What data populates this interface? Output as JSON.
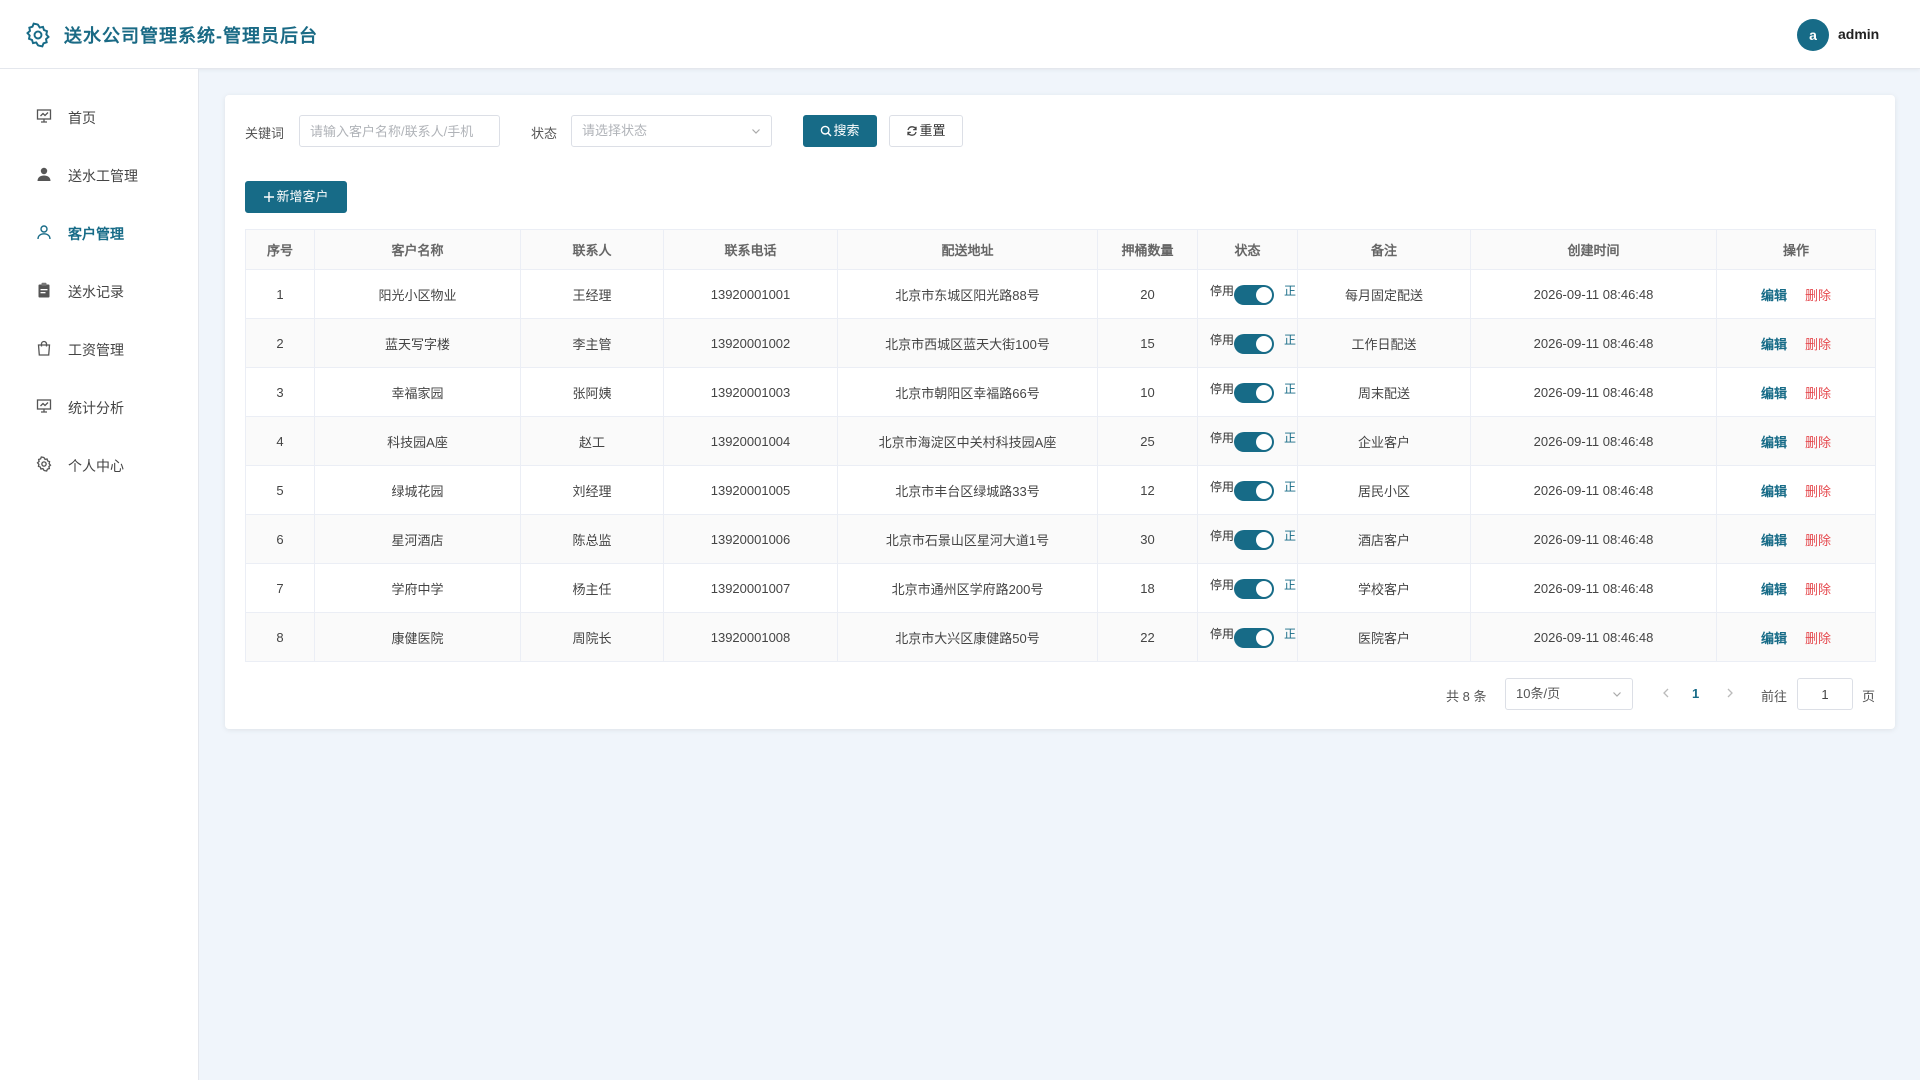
{
  "header": {
    "title": "送水公司管理系统-管理员后台",
    "avatar_letter": "a",
    "username": "admin",
    "logo_icon": "gear-icon"
  },
  "sidebar": {
    "items": [
      {
        "label": "首页",
        "icon": "presentation-icon",
        "active": false
      },
      {
        "label": "送水工管理",
        "icon": "user-filled-icon",
        "active": false
      },
      {
        "label": "客户管理",
        "icon": "user-outline-icon",
        "active": true
      },
      {
        "label": "送水记录",
        "icon": "clipboard-icon",
        "active": false
      },
      {
        "label": "工资管理",
        "icon": "shopping-bag-icon",
        "active": false
      },
      {
        "label": "统计分析",
        "icon": "presentation-icon",
        "active": false
      },
      {
        "label": "个人中心",
        "icon": "gear-icon",
        "active": false
      }
    ]
  },
  "search": {
    "keyword_label": "关键词",
    "keyword_placeholder": "请输入客户名称/联系人/手机",
    "status_label": "状态",
    "status_placeholder": "请选择状态",
    "search_button": "搜索",
    "reset_button": "重置",
    "add_button": "新增客户"
  },
  "table": {
    "columns": [
      "序号",
      "客户名称",
      "联系人",
      "联系电话",
      "配送地址",
      "押桶数量",
      "状态",
      "备注",
      "创建时间",
      "操作"
    ],
    "status_off": "停用",
    "status_on": "正常",
    "edit_label": "编辑",
    "delete_label": "删除",
    "rows": [
      {
        "no": "1",
        "name": "阳光小区物业",
        "contact": "王经理",
        "phone": "13920001001",
        "address": "北京市东城区阳光路88号",
        "buckets": "20",
        "enabled": true,
        "remark": "每月固定配送",
        "created": "2026-09-11 08:46:48"
      },
      {
        "no": "2",
        "name": "蓝天写字楼",
        "contact": "李主管",
        "phone": "13920001002",
        "address": "北京市西城区蓝天大街100号",
        "buckets": "15",
        "enabled": true,
        "remark": "工作日配送",
        "created": "2026-09-11 08:46:48"
      },
      {
        "no": "3",
        "name": "幸福家园",
        "contact": "张阿姨",
        "phone": "13920001003",
        "address": "北京市朝阳区幸福路66号",
        "buckets": "10",
        "enabled": true,
        "remark": "周末配送",
        "created": "2026-09-11 08:46:48"
      },
      {
        "no": "4",
        "name": "科技园A座",
        "contact": "赵工",
        "phone": "13920001004",
        "address": "北京市海淀区中关村科技园A座",
        "buckets": "25",
        "enabled": true,
        "remark": "企业客户",
        "created": "2026-09-11 08:46:48"
      },
      {
        "no": "5",
        "name": "绿城花园",
        "contact": "刘经理",
        "phone": "13920001005",
        "address": "北京市丰台区绿城路33号",
        "buckets": "12",
        "enabled": true,
        "remark": "居民小区",
        "created": "2026-09-11 08:46:48"
      },
      {
        "no": "6",
        "name": "星河酒店",
        "contact": "陈总监",
        "phone": "13920001006",
        "address": "北京市石景山区星河大道1号",
        "buckets": "30",
        "enabled": true,
        "remark": "酒店客户",
        "created": "2026-09-11 08:46:48"
      },
      {
        "no": "7",
        "name": "学府中学",
        "contact": "杨主任",
        "phone": "13920001007",
        "address": "北京市通州区学府路200号",
        "buckets": "18",
        "enabled": true,
        "remark": "学校客户",
        "created": "2026-09-11 08:46:48"
      },
      {
        "no": "8",
        "name": "康健医院",
        "contact": "周院长",
        "phone": "13920001008",
        "address": "北京市大兴区康健路50号",
        "buckets": "22",
        "enabled": true,
        "remark": "医院客户",
        "created": "2026-09-11 08:46:48"
      }
    ]
  },
  "pagination": {
    "total_text": "共 8 条",
    "page_size": "10条/页",
    "current_page": "1",
    "goto_label": "前往",
    "goto_value": "1",
    "page_unit": "页"
  },
  "colors": {
    "primary": "#176b87",
    "danger": "#e5484d",
    "background": "#f0f5fb"
  }
}
